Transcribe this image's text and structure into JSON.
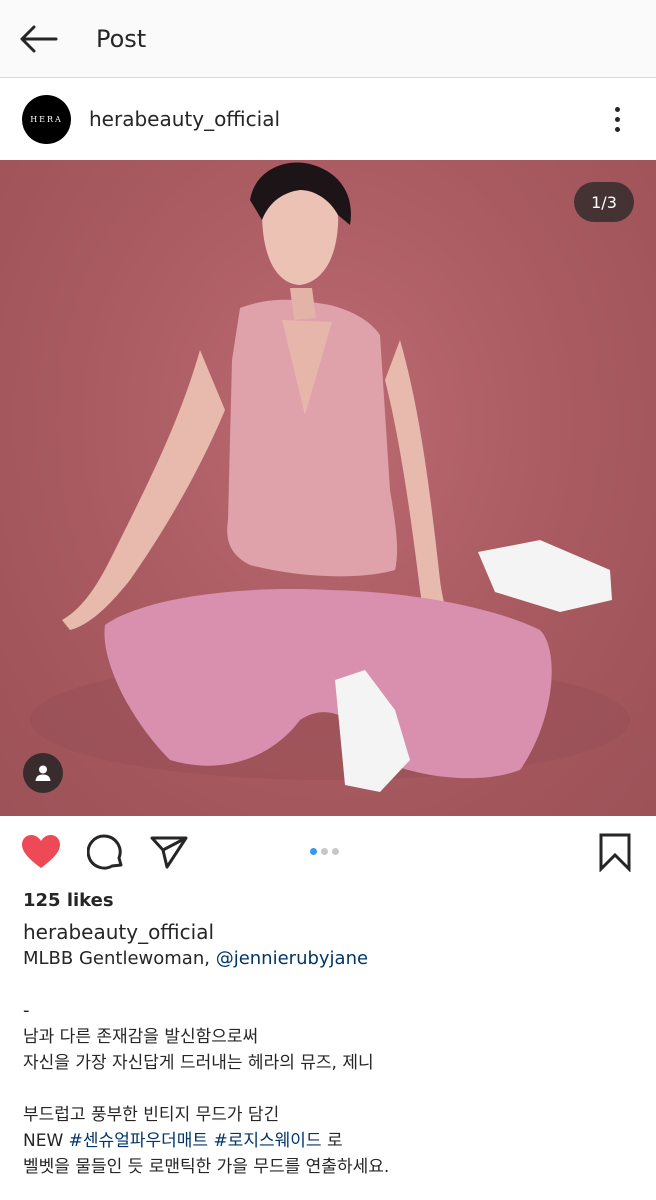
{
  "header": {
    "title": "Post"
  },
  "post": {
    "username": "herabeauty_official",
    "avatar_text": "HERA",
    "image_counter": "1/3",
    "image_count": 3,
    "current_image": 1,
    "likes": "125 likes",
    "caption": {
      "author": "herabeauty_official",
      "line1_text": "MLBB Gentlewoman, ",
      "line1_mention": "@jennierubyjane",
      "separator": "-",
      "line2": "남과 다른 존재감을 발신함으로써",
      "line3": "자신을 가장 자신답게 드러내는 헤라의 뮤즈, 제니",
      "line4": "부드럽고 풍부한 빈티지 무드가 담긴",
      "line5_prefix": "NEW ",
      "line5_tag1": "#센슈얼파우더매트",
      "line5_tag2": "#로지스웨이드",
      "line5_suffix": " 로",
      "line6": "벨벳을 물들인 듯 로맨틱한 가을 무드를 연출하세요."
    }
  },
  "icons": {
    "back": "arrow-left-icon",
    "more": "more-vertical-icon",
    "tagged": "person-icon",
    "like": "heart-icon",
    "comment": "comment-icon",
    "share": "send-icon",
    "save": "bookmark-icon"
  },
  "colors": {
    "like_active": "#ed4956",
    "link": "#003569",
    "carousel_active_dot": "#3897f0"
  }
}
